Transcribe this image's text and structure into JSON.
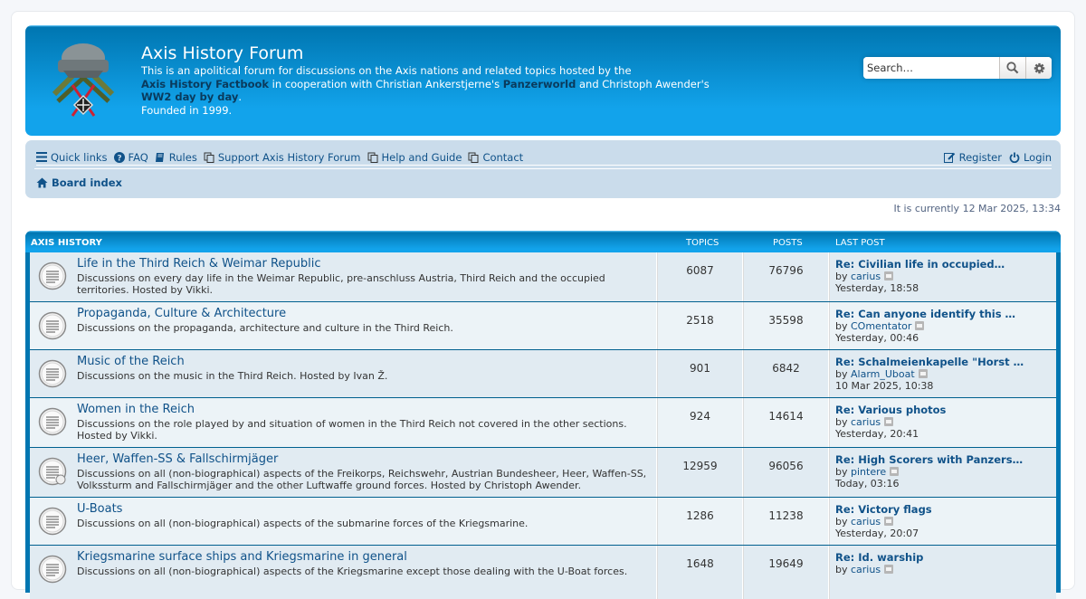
{
  "header": {
    "title": "Axis History Forum",
    "desc_line1": "This is an apolitical forum for discussions on the Axis nations and related topics hosted by the",
    "link_factbook": "Axis History Factbook",
    "desc_line2": " in cooperation with Christian Ankerstjerne's ",
    "link_panzerworld": "Panzerworld",
    "desc_line3": " and Christoph Awender's",
    "link_ww2": "WW2 day by day",
    "desc_line4": ".",
    "founded": "Founded in 1999.",
    "search_placeholder": "Search…"
  },
  "nav": {
    "items": [
      "Quick links",
      "FAQ",
      "Rules",
      "Support Axis History Forum",
      "Help and Guide",
      "Contact"
    ],
    "register": "Register",
    "login": "Login",
    "board_index": "Board index"
  },
  "current_time": "It is currently 12 Mar 2025, 13:34",
  "forum_section": {
    "name": "Axis History",
    "col_topics": "Topics",
    "col_posts": "Posts",
    "col_last": "Last post",
    "forums": [
      {
        "title": "Life in the Third Reich & Weimar Republic",
        "desc": "Discussions on every day life in the Weimar Republic, pre-anschluss Austria, Third Reich and the occupied territories. Hosted by Vikki.",
        "topics": "6087",
        "posts": "76796",
        "last_title": "Re: Civilian life in occupied…",
        "last_by": "carius",
        "last_time": "Yesterday, 18:58"
      },
      {
        "title": "Propaganda, Culture & Architecture",
        "desc": "Discussions on the propaganda, architecture and culture in the Third Reich.",
        "topics": "2518",
        "posts": "35598",
        "last_title": "Re: Can anyone identify this …",
        "last_by": "COmentator",
        "last_time": "Yesterday, 00:46"
      },
      {
        "title": "Music of the Reich",
        "desc": "Discussions on the music in the Third Reich. Hosted by Ivan Ž.",
        "topics": "901",
        "posts": "6842",
        "last_title": "Re: Schalmeienkapelle \"Horst …",
        "last_by": "Alarm_Uboat",
        "last_time": "10 Mar 2025, 10:38"
      },
      {
        "title": "Women in the Reich",
        "desc": "Discussions on the role played by and situation of women in the Third Reich not covered in the other sections. Hosted by Vikki.",
        "topics": "924",
        "posts": "14614",
        "last_title": "Re: Various photos",
        "last_by": "carius",
        "last_time": "Yesterday, 20:41"
      },
      {
        "title": "Heer, Waffen-SS & Fallschirmjäger",
        "desc": "Discussions on all (non-biographical) aspects of the Freikorps, Reichswehr, Austrian Bundesheer, Heer, Waffen-SS, Volkssturm and Fallschirmjäger and the other Luftwaffe ground forces. Hosted by Christoph Awender.",
        "topics": "12959",
        "posts": "96056",
        "last_title": "Re: High Scorers with Panzers…",
        "last_by": "pintere",
        "last_time": "Today, 03:16"
      },
      {
        "title": "U-Boats",
        "desc": "Discussions on all (non-biographical) aspects of the submarine forces of the Kriegsmarine.",
        "topics": "1286",
        "posts": "11238",
        "last_title": "Re: Victory flags",
        "last_by": "carius",
        "last_time": "Yesterday, 20:07"
      },
      {
        "title": "Kriegsmarine surface ships and Kriegsmarine in general",
        "desc": "Discussions on all (non-biographical) aspects of the Kriegsmarine except those dealing with the U-Boat forces.",
        "topics": "1648",
        "posts": "19649",
        "last_title": "Re: Id. warship",
        "last_by": "carius",
        "last_time": ""
      }
    ]
  },
  "labels": {
    "by": "by"
  },
  "colors": {
    "header_blue": "#12a3eb",
    "nav_bg": "#cadceb",
    "link": "#105289"
  }
}
